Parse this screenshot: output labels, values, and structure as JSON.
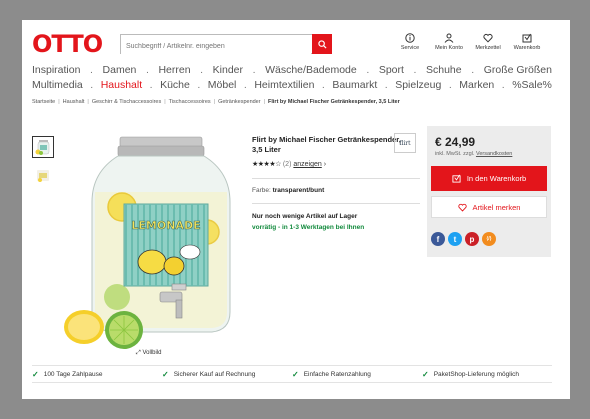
{
  "header": {
    "logo": "OTTO",
    "search_placeholder": "Suchbegriff / Artikelnr. eingeben",
    "services": [
      {
        "label": "Service",
        "icon": "info-icon"
      },
      {
        "label": "Mein Konto",
        "icon": "user-icon"
      },
      {
        "label": "Merkzettel",
        "icon": "heart-icon"
      },
      {
        "label": "Warenkorb",
        "icon": "cart-icon"
      }
    ]
  },
  "nav": {
    "row1": [
      "Inspiration",
      "Damen",
      "Herren",
      "Kinder",
      "Wäsche/Bademode",
      "Sport",
      "Schuhe",
      "Große Größen"
    ],
    "row2": [
      "Multimedia",
      "Haushalt",
      "Küche",
      "Möbel",
      "Heimtextilien",
      "Baumarkt",
      "Spielzeug",
      "Marken",
      "%Sale%"
    ],
    "separator": ".",
    "active": "Haushalt"
  },
  "breadcrumb": {
    "items": [
      "Startseite",
      "Haushalt",
      "Geschirr & Tischaccessoires",
      "Tischaccessoires",
      "Getränkespender"
    ],
    "current": "Flirt by Michael Fischer Getränkespender, 3,5 Liter",
    "separator": "|"
  },
  "gallery": {
    "vollbild": "Vollbild",
    "label_text": "LEMONADE"
  },
  "product": {
    "title": "Flirt by Michael Fischer Getränkespender, 3,5 Liter",
    "brand_logo": "flirt",
    "stars": "★★★★☆",
    "rating": 4,
    "rating_count": "(2)",
    "rating_link": "anzeigen",
    "color_label": "Farbe:",
    "color_value": "transparent/bunt",
    "stock": "Nur noch wenige Artikel auf Lager",
    "delivery": "vorrätig - in 1-3 Werktagen bei Ihnen"
  },
  "buybox": {
    "price": "€ 24,99",
    "vat_text": "inkl. MwSt. zzgl.",
    "shipping_link": "Versandkosten",
    "cart_button": "In den Warenkorb",
    "wish_button": "Artikel merken",
    "share": [
      {
        "name": "facebook",
        "glyph": "f",
        "color": "#3b5998"
      },
      {
        "name": "twitter",
        "glyph": "t",
        "color": "#1da1f2"
      },
      {
        "name": "pinterest",
        "glyph": "p",
        "color": "#cb2027"
      },
      {
        "name": "share",
        "glyph": "⟨/⟩",
        "color": "#f28c1e"
      }
    ]
  },
  "benefits": [
    "100 Tage Zahlpause",
    "Sicherer Kauf auf Rechnung",
    "Einfache Ratenzahlung",
    "PaketShop-Lieferung möglich"
  ],
  "colors": {
    "brand": "#e3151b",
    "stock_green": "#118a3c"
  }
}
